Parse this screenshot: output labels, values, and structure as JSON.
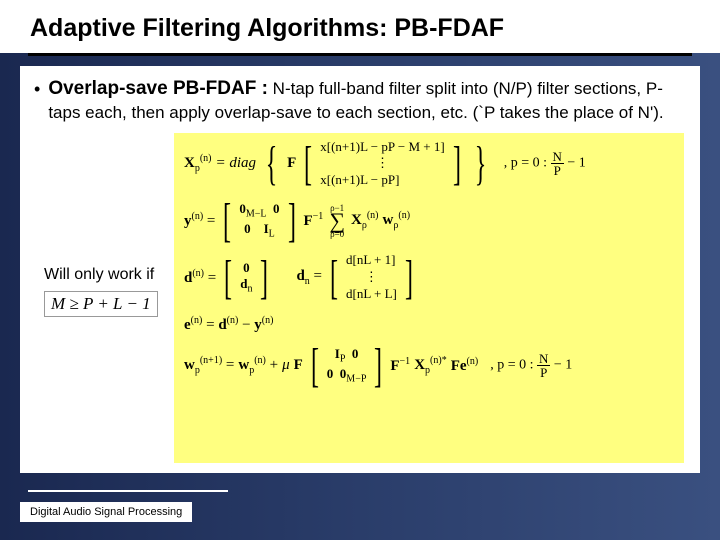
{
  "title": "Adaptive Filtering Algorithms: PB-FDAF",
  "bullet": {
    "lead": "Overlap-save PB-FDAF :",
    "rest": "N-tap full-band filter split into (N/P) filter sections, P-taps each, then apply overlap-save to each section, etc. (`P takes the place of N')."
  },
  "note": "Will only work if",
  "condition": "M ≥ P + L − 1",
  "footer": "Digital Audio Signal Processing",
  "eq1": {
    "lhs_pre": "X",
    "lhs_sub": "p",
    "lhs_sup": "(n)",
    "op": " = diag",
    "F": "F",
    "row1": "x[(n+1)L − pP − M + 1]",
    "row2": "⋮",
    "row3": "x[(n+1)L − pP]",
    "rhs_tail": ",   p = 0 :",
    "frac_top": "N",
    "frac_bot": "P",
    "tail2": "− 1"
  },
  "eq2": {
    "lhs": "y",
    "lhs_sup": "(n)",
    "m1a": "0",
    "m1a_sub": "M−L",
    "m1b": "0",
    "m2a": "0",
    "m2b": "I",
    "m2b_sub": "L",
    "F": "F",
    "Fm1": "−1",
    "sum_top": "ρ−1",
    "sum_bot": "ρ=0",
    "X": "X",
    "X_sub": "ρ",
    "X_sup": "(n)",
    "w": "w",
    "w_sub": "ρ",
    "w_sup": "(n)"
  },
  "eq3": {
    "lhs": "d",
    "lhs_sup": "(n)",
    "r1": "0",
    "r2": "d",
    "r2_sub": "n",
    "dn": "d",
    "dn_sub": "n",
    "rr1": "d[nL + 1]",
    "rr2": "⋮",
    "rr3": "d[nL + L]"
  },
  "eq4": {
    "lhs": "e",
    "lhs_sup": "(n)",
    "a": "d",
    "a_sup": "(n)",
    "b": "y",
    "b_sup": "(n)"
  },
  "eq5": {
    "lhs": "w",
    "lhs_sub": "p",
    "lhs_sup": "(n+1)",
    "a": "w",
    "a_sub": "p",
    "a_sup": "(n)",
    "mu": "μ",
    "F": "F",
    "m1a": "I",
    "m1a_sub": "P",
    "m1b": "0",
    "m2a": "0",
    "m2b": "0",
    "m2b_sub": "M−P",
    "Fm1": "−1",
    "X": "X",
    "X_sub": "p",
    "X_sup": "(n)*",
    "Fe": "Fe",
    "Fe_sup": "(n)",
    "tail": ",  p = 0 :",
    "frac_top": "N",
    "frac_bot": "P",
    "tail2": "− 1"
  }
}
